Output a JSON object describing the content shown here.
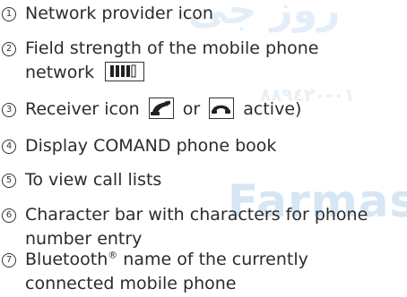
{
  "items": [
    {
      "number": "1",
      "text": "Network provider icon"
    },
    {
      "number": "2",
      "text_line1": "Field strength of the mobile phone",
      "text_line2": "network"
    },
    {
      "number": "3",
      "text_a": "Receiver icon",
      "text_or": "or",
      "text_b": "active)"
    },
    {
      "number": "4",
      "text": "Display COMAND phone book"
    },
    {
      "number": "5",
      "text": "To view call lists"
    },
    {
      "number": "6",
      "text_line1": "Character bar with characters for phone",
      "text_line2": "number entry"
    },
    {
      "number": "7",
      "text_line1_pre": "Bluetooth",
      "text_line1_sup": "®",
      "text_line1_post": " name of the currently",
      "text_line2": "connected mobile phone"
    }
  ],
  "signal_strength": {
    "bars_filled": 4,
    "bars_total": 5
  },
  "icons": {
    "signal": "signal-strength-icon",
    "receiver_lifted": "receiver-lifted-icon",
    "receiver_down": "receiver-down-icon"
  },
  "watermarks": {
    "top": "روز جی",
    "phone": "٠١-٨٨٩٤٢٠",
    "brand": "Farmas"
  },
  "colors": {
    "text": "#2b2b2b",
    "watermark_blue": "#d6e6f4"
  }
}
